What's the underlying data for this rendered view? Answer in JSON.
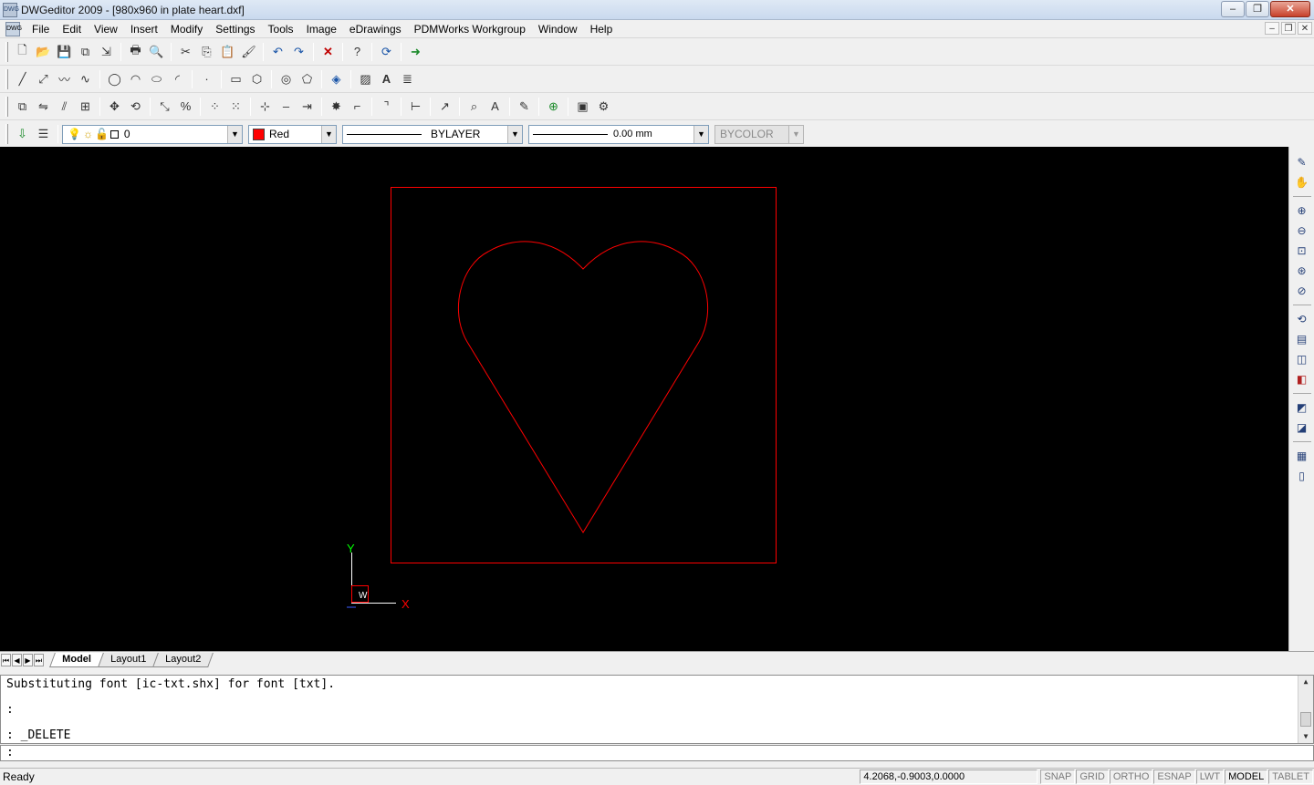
{
  "window": {
    "title": "DWGeditor 2009 - [980x960 in plate heart.dxf]",
    "app_icon_text": "DWG",
    "controls": {
      "minimize": "–",
      "maximize": "❐",
      "close": "✕"
    }
  },
  "menu": {
    "items": [
      "File",
      "Edit",
      "View",
      "Insert",
      "Modify",
      "Settings",
      "Tools",
      "Image",
      "eDrawings",
      "PDMWorks Workgroup",
      "Window",
      "Help"
    ],
    "mdi_controls": {
      "minimize": "–",
      "restore": "❐",
      "close": "✕"
    }
  },
  "toolbars": {
    "standard": [
      "new",
      "open",
      "save",
      "save-all",
      "export",
      "print",
      "print-preview",
      "cut",
      "copy",
      "paste",
      "match-properties",
      "undo",
      "redo",
      "delete",
      "help",
      "refresh",
      "edrawings-publish"
    ],
    "draw": [
      "line",
      "ray",
      "polyline",
      "spline",
      "circle",
      "arc",
      "ellipse",
      "ellipse-arc",
      "point",
      "rectangle",
      "polygon",
      "donut",
      "region",
      "3d-face",
      "hatch",
      "text",
      "multiline-text"
    ],
    "modify": [
      "copy",
      "mirror",
      "offset",
      "array",
      "move",
      "rotate",
      "scale",
      "stretch",
      "array-rect",
      "array-polar",
      "break",
      "trim",
      "extend",
      "explode",
      "fillet",
      "chamfer",
      "dimension",
      "leader",
      "measure",
      "find",
      "text-style",
      "pencil",
      "insert-block",
      "block-properties",
      "attributes"
    ]
  },
  "properties": {
    "layer": {
      "name": "0",
      "icons": [
        "lightbulb",
        "sun",
        "lock",
        "color-square"
      ]
    },
    "color": {
      "name": "Red",
      "swatch": "#ff0000"
    },
    "linetype": {
      "name": "BYLAYER"
    },
    "lineweight": {
      "name": "0.00 mm"
    },
    "plotstyle": {
      "name": "BYCOLOR"
    }
  },
  "drawing": {
    "background": "#000000",
    "entity_color": "#ff0000",
    "ucs": {
      "x_label": "X",
      "y_label": "Y",
      "w_label": "W"
    }
  },
  "right_toolbar": [
    "pan-icon",
    "hand-icon",
    "zoom-in-icon",
    "zoom-out-icon",
    "zoom-window-icon",
    "zoom-realtime-icon",
    "zoom-previous-icon",
    "orbit-icon",
    "view-named-icon",
    "view-3d-icon",
    "render-icon",
    "shade-icon",
    "shade-flat-icon",
    "table-icon",
    "properties-icon"
  ],
  "layout_tabs": {
    "nav": [
      "⏮",
      "◀",
      "▶",
      "⏭"
    ],
    "tabs": [
      "Model",
      "Layout1",
      "Layout2"
    ],
    "active": "Model"
  },
  "command": {
    "history": [
      "Substituting font [ic-txt.shx] for font [txt].",
      "",
      ":",
      ": _DELETE"
    ],
    "prompt": ":"
  },
  "status": {
    "message": "Ready",
    "coordinates": "4.2068,-0.9003,0.0000",
    "toggles": [
      {
        "label": "SNAP",
        "on": false
      },
      {
        "label": "GRID",
        "on": false
      },
      {
        "label": "ORTHO",
        "on": false
      },
      {
        "label": "ESNAP",
        "on": false
      },
      {
        "label": "LWT",
        "on": false
      },
      {
        "label": "MODEL",
        "on": true
      },
      {
        "label": "TABLET",
        "on": false
      }
    ]
  }
}
